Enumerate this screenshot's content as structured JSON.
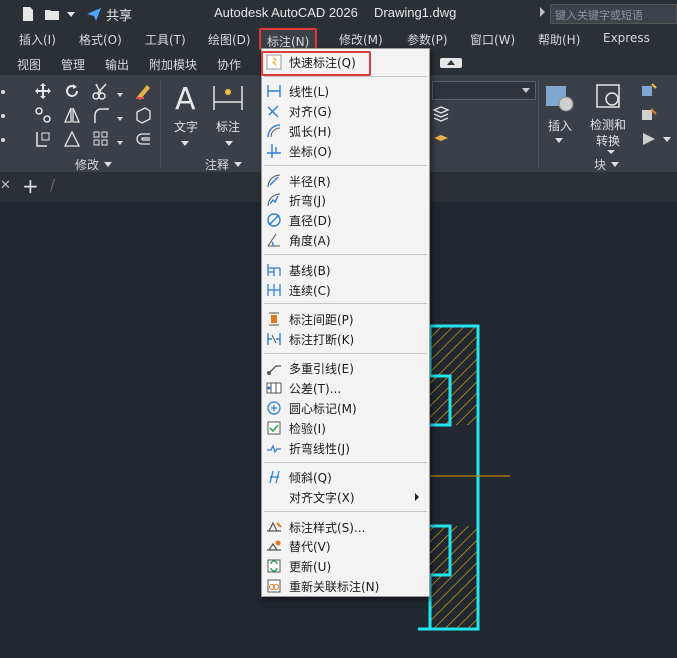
{
  "titlebar": {
    "share_label": "共享",
    "app_title": "Autodesk AutoCAD 2026",
    "doc_title": "Drawing1.dwg",
    "search_placeholder": "键入关键字或短语"
  },
  "menubar": {
    "items": [
      "插入(I)",
      "格式(O)",
      "工具(T)",
      "绘图(D)",
      "标注(N)",
      "修改(M)",
      "参数(P)",
      "窗口(W)",
      "帮助(H)",
      "Express"
    ],
    "active_index": 4
  },
  "ribbon_tabs": [
    "视图",
    "管理",
    "输出",
    "附加模块",
    "协作"
  ],
  "ribbon": {
    "modify_panel": "修改",
    "annotation_panel": "注释",
    "block_panel": "块",
    "text_label": "文字",
    "dimension_label": "标注",
    "insert_label": "插入",
    "measure_label_1": "检测和",
    "measure_label_2": "转换"
  },
  "dimension_menu": {
    "groups": [
      [
        {
          "label": "快速标注(Q)",
          "icon": "quick-dimension-icon"
        }
      ],
      [
        {
          "label": "线性(L)",
          "icon": "linear-dimension-icon"
        },
        {
          "label": "对齐(G)",
          "icon": "aligned-dimension-icon"
        },
        {
          "label": "弧长(H)",
          "icon": "arc-length-icon"
        },
        {
          "label": "坐标(O)",
          "icon": "ordinate-dimension-icon"
        }
      ],
      [
        {
          "label": "半径(R)",
          "icon": "radius-dimension-icon"
        },
        {
          "label": "折弯(J)",
          "icon": "jogged-dimension-icon"
        },
        {
          "label": "直径(D)",
          "icon": "diameter-dimension-icon"
        },
        {
          "label": "角度(A)",
          "icon": "angular-dimension-icon"
        }
      ],
      [
        {
          "label": "基线(B)",
          "icon": "baseline-dimension-icon"
        },
        {
          "label": "连续(C)",
          "icon": "continue-dimension-icon"
        }
      ],
      [
        {
          "label": "标注间距(P)",
          "icon": "dimension-space-icon"
        },
        {
          "label": "标注打断(K)",
          "icon": "dimension-break-icon"
        }
      ],
      [
        {
          "label": "多重引线(E)",
          "icon": "multileader-icon"
        },
        {
          "label": "公差(T)...",
          "icon": "tolerance-icon"
        },
        {
          "label": "圆心标记(M)",
          "icon": "center-mark-icon"
        },
        {
          "label": "检验(I)",
          "icon": "inspection-icon"
        },
        {
          "label": "折弯线性(J)",
          "icon": "jogged-linear-icon"
        }
      ],
      [
        {
          "label": "倾斜(Q)",
          "icon": "oblique-icon"
        },
        {
          "label": "对齐文字(X)",
          "icon": "",
          "submenu": true
        }
      ],
      [
        {
          "label": "标注样式(S)...",
          "icon": "dimension-style-icon"
        },
        {
          "label": "替代(V)",
          "icon": "override-icon"
        },
        {
          "label": "更新(U)",
          "icon": "update-icon"
        },
        {
          "label": "重新关联标注(N)",
          "icon": "reassociate-icon"
        }
      ]
    ]
  },
  "colors": {
    "outline": "#22e6ee",
    "hatch": "#d6a21e",
    "centerline": "#b8860b",
    "icon_blue": "#2f7fd6",
    "icon_orange": "#e07a1f",
    "highlight": "#e03a3a"
  }
}
